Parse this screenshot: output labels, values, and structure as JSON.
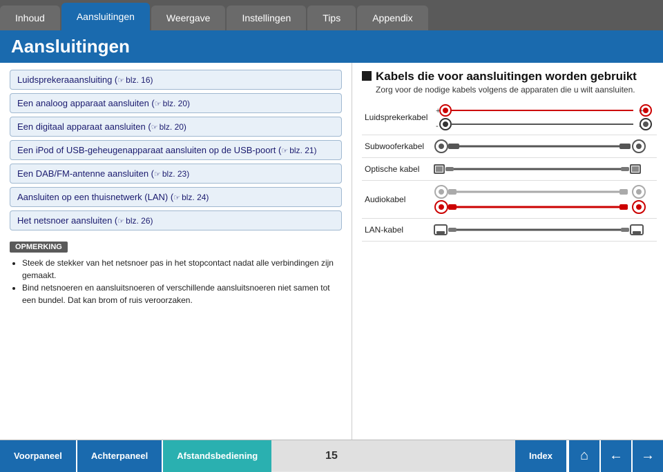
{
  "nav": {
    "tabs": [
      {
        "label": "Inhoud",
        "active": false
      },
      {
        "label": "Aansluitingen",
        "active": true
      },
      {
        "label": "Weergave",
        "active": false
      },
      {
        "label": "Instellingen",
        "active": false
      },
      {
        "label": "Tips",
        "active": false
      },
      {
        "label": "Appendix",
        "active": false
      }
    ]
  },
  "header": {
    "title": "Aansluitingen"
  },
  "left": {
    "nav_items": [
      {
        "label": "Luidsprekeraaansluiting (",
        "ref": "blz. 16)",
        "full": "Luidsprekeraaansluiting (☞blz. 16)"
      },
      {
        "label": "Een analoog apparaat aansluiten (",
        "ref": "blz. 20)",
        "full": "Een analoog apparaat aansluiten (☞blz. 20)"
      },
      {
        "label": "Een digitaal apparaat aansluiten (",
        "ref": "blz. 20)",
        "full": "Een digitaal apparaat aansluiten (☞blz. 20)"
      },
      {
        "label": "Een iPod of USB-geheugenapparaat aansluiten op de USB-poort (",
        "ref": "blz. 21)",
        "full": "Een iPod of USB-geheugenapparaat aansluiten op de USB-poort (☞blz. 21)"
      },
      {
        "label": "Een DAB/FM-antenne aansluiten (",
        "ref": "blz. 23)",
        "full": "Een DAB/FM-antenne aansluiten (☞blz. 23)"
      },
      {
        "label": "Aansluiten op een thuisnetwerk (LAN) (",
        "ref": "blz. 24)",
        "full": "Aansluiten op een thuisnetwerk (LAN) (☞blz. 24)"
      },
      {
        "label": "Het netsnoer aansluiten (",
        "ref": "blz. 26)",
        "full": "Het netsnoer aansluiten (☞blz. 26)"
      }
    ],
    "opmerking_label": "OPMERKING",
    "opmerking_items": [
      "Steek de stekker van het netsnoer pas in het stopcontact nadat alle verbindingen zijn gemaakt.",
      "Bind netsnoeren en aansluitsnoeren of verschillende aansluitsnoeren niet samen tot een bundel. Dat kan brom of ruis veroorzaken."
    ]
  },
  "right": {
    "section_title": "Kabels die voor aansluitingen worden gebruikt",
    "section_subtitle": "Zorg voor de nodige kabels volgens de apparaten die u wilt aansluiten.",
    "cables": [
      {
        "label": "Luidsprekerkabel"
      },
      {
        "label": "Subwooferkabel"
      },
      {
        "label": "Optische kabel"
      },
      {
        "label": "Audiokabel"
      },
      {
        "label": "LAN-kabel"
      }
    ]
  },
  "bottom": {
    "buttons": [
      {
        "label": "Voorpaneel"
      },
      {
        "label": "Achterpaneel"
      },
      {
        "label": "Afstandsbediening"
      },
      {
        "label": "Index"
      }
    ],
    "page_number": "15",
    "icons": [
      "⌂",
      "←",
      "→"
    ]
  }
}
